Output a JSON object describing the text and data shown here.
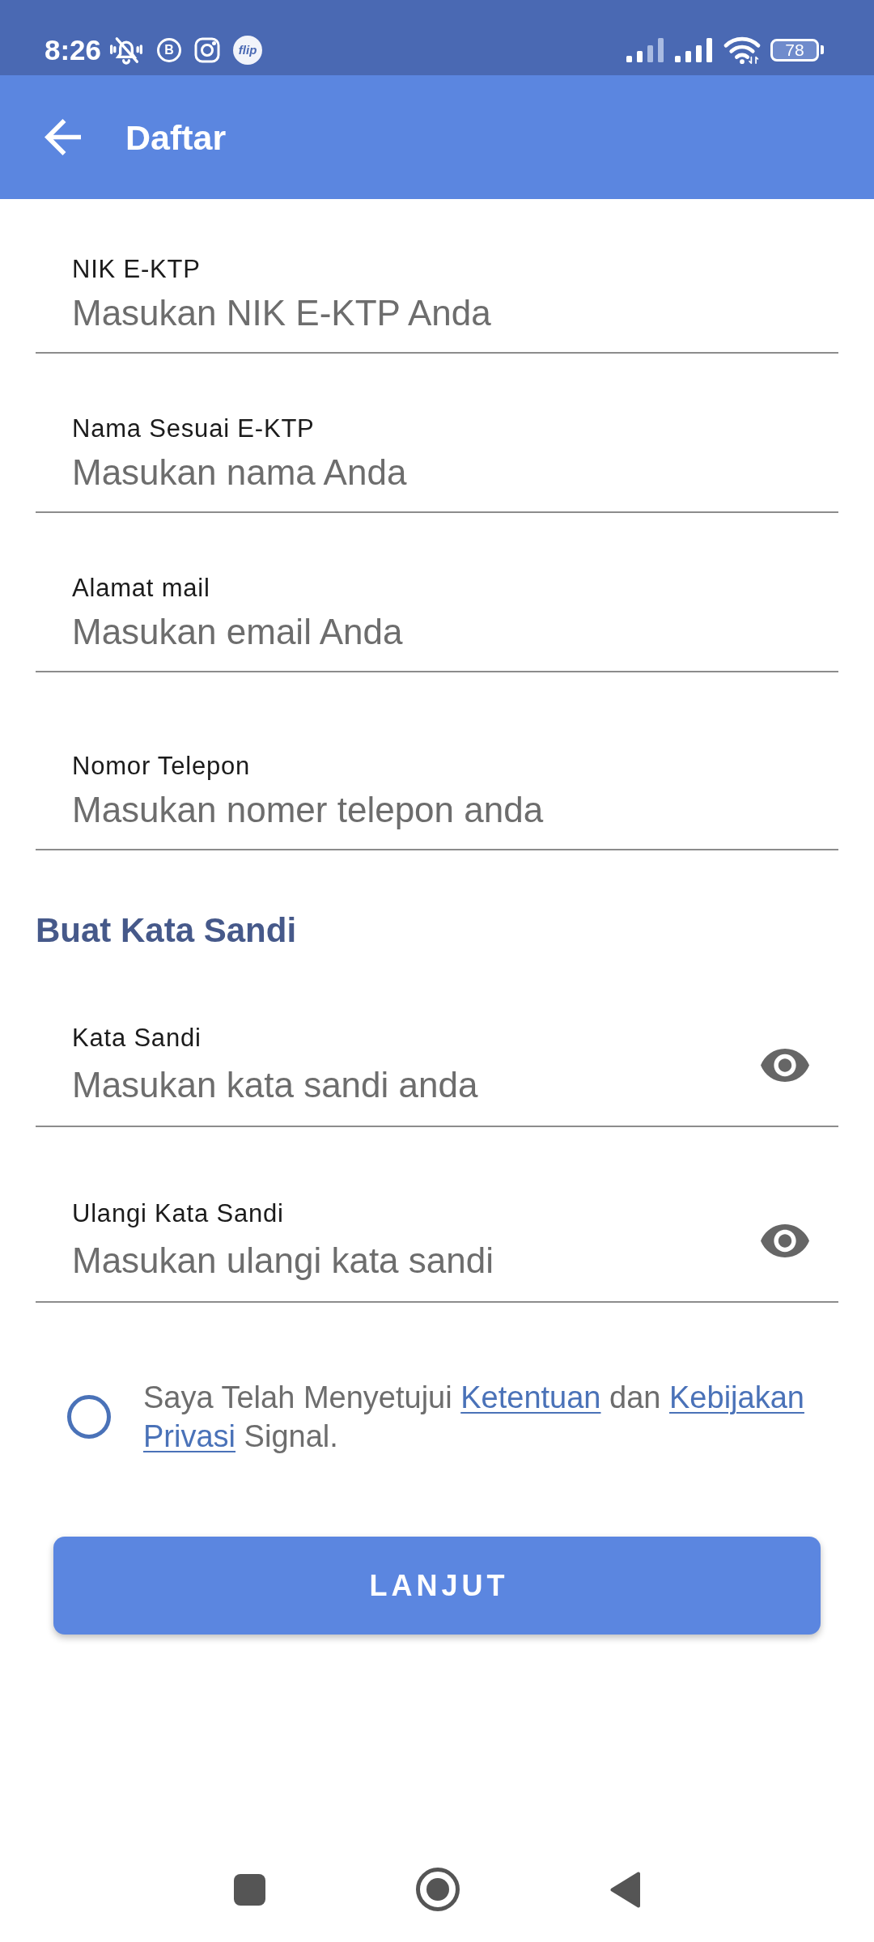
{
  "status_bar": {
    "time": "8:26",
    "chat_badge_letter": "B",
    "app_badge": "flip",
    "battery": "78"
  },
  "app_bar": {
    "title": "Daftar"
  },
  "fields": [
    {
      "kind": "text",
      "label": "NIK E-KTP",
      "placeholder": "Masukan NIK E-KTP Anda"
    },
    {
      "kind": "text",
      "label": "Nama Sesuai E-KTP",
      "placeholder": "Masukan nama Anda"
    },
    {
      "kind": "text",
      "label": "Alamat mail",
      "placeholder": "Masukan email Anda"
    },
    {
      "kind": "text",
      "label": "Nomor Telepon",
      "placeholder": "Masukan nomer telepon anda"
    }
  ],
  "password_section": {
    "title": "Buat Kata Sandi",
    "fields": [
      {
        "kind": "password",
        "label": "Kata Sandi",
        "placeholder": "Masukan kata sandi anda"
      },
      {
        "kind": "password",
        "label": "Ulangi Kata Sandi",
        "placeholder": "Masukan ulangi kata sandi"
      }
    ]
  },
  "consent": {
    "checked": false,
    "parts": [
      {
        "kind": "text",
        "text": "Saya Telah Menyetujui"
      },
      {
        "kind": "link",
        "text": "Ketentuan"
      },
      {
        "kind": "text",
        "text": "dan"
      },
      {
        "kind": "link",
        "text": "Kebijakan"
      },
      {
        "kind": "link",
        "text": "Privasi"
      },
      {
        "kind": "text",
        "text": "Signal."
      }
    ]
  },
  "submit_button": {
    "label": "LANJUT"
  }
}
